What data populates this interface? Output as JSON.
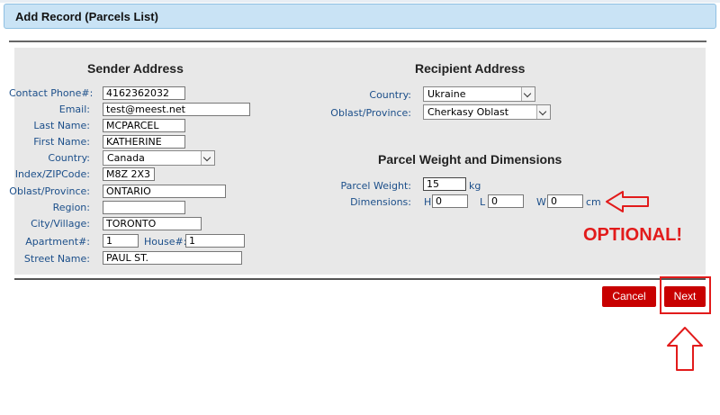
{
  "window": {
    "title": "Add Record (Parcels List)"
  },
  "sender": {
    "heading": "Sender Address",
    "fields": [
      {
        "label": "Contact Phone#:",
        "value": "4162362032"
      },
      {
        "label": "Email:",
        "value": "test@meest.net"
      },
      {
        "label": "Last Name:",
        "value": "MCPARCEL"
      },
      {
        "label": "First Name:",
        "value": "KATHERINE"
      },
      {
        "label": "Country:",
        "value": "Canada"
      },
      {
        "label": "Index/ZIPCode:",
        "value": "M8Z 2X3"
      },
      {
        "label": "Oblast/Province:",
        "value": "ONTARIO"
      },
      {
        "label": "Region:",
        "value": ""
      },
      {
        "label": "City/Village:",
        "value": "TORONTO"
      },
      {
        "label": "Apartment#:",
        "value": "1"
      },
      {
        "label": "House#:",
        "value": "1"
      },
      {
        "label": "Street Name:",
        "value": "PAUL ST."
      }
    ]
  },
  "recipient": {
    "heading": "Recipient Address",
    "country_label": "Country:",
    "country_value": "Ukraine",
    "oblast_label": "Oblast/Province:",
    "oblast_value": "Cherkasy Oblast"
  },
  "parcel": {
    "heading": "Parcel Weight and Dimensions",
    "weight_label": "Parcel Weight:",
    "weight_value": "15",
    "weight_unit": "kg",
    "dimensions_label": "Dimensions:",
    "h_label": "H",
    "h_value": "0",
    "l_label": "L",
    "l_value": "0",
    "w_label": "W",
    "w_value": "0",
    "dim_unit": "cm"
  },
  "annotations": {
    "optional_text": "OPTIONAL!",
    "accent_color": "#e21b1b"
  },
  "buttons": {
    "cancel": "Cancel",
    "next": "Next"
  }
}
